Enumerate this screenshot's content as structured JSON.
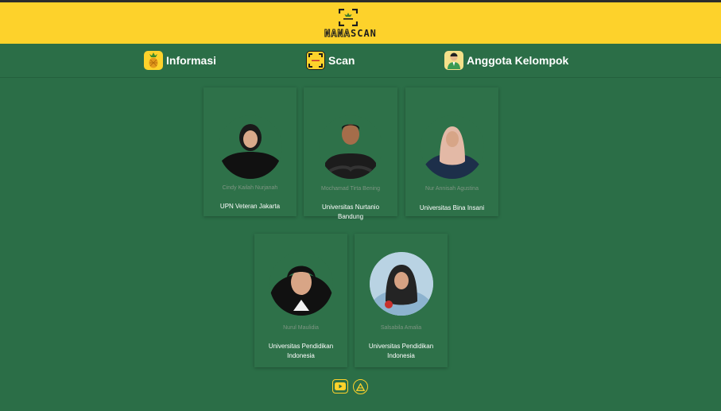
{
  "brand": {
    "name_part1": "NANA",
    "name_part2": "SCAN"
  },
  "colors": {
    "header_bg": "#fdd22b",
    "page_bg": "#2b6e47",
    "accent": "#fdd22b"
  },
  "nav": {
    "items": [
      {
        "label": "Informasi",
        "icon": "pineapple-icon"
      },
      {
        "label": "Scan",
        "icon": "scan-icon"
      },
      {
        "label": "Anggota Kelompok",
        "icon": "person-icon"
      }
    ]
  },
  "members": [
    {
      "name": "Cindy Kailah Nurjanah",
      "university": "UPN Veteran Jakarta"
    },
    {
      "name": "Mochamad Tirta Bening",
      "university": "Universitas Nurtanio Bandung"
    },
    {
      "name": "Nur Annisah Agustina",
      "university": "Universitas Bina Insani"
    },
    {
      "name": "Nurul Maulidia",
      "university": "Universitas Pendidikan Indonesia"
    },
    {
      "name": "Salsabila Amalia",
      "university": "Universitas Pendidikan Indonesia"
    }
  ],
  "footer": {
    "icons": [
      "youtube-icon",
      "dicoding-icon"
    ]
  }
}
